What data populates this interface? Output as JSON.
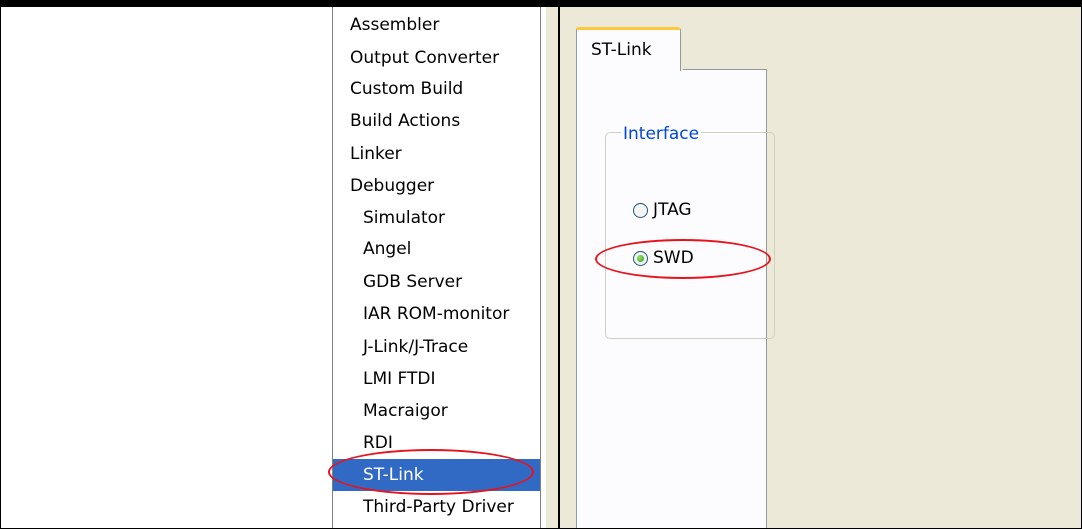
{
  "category_list": {
    "items": [
      {
        "label": "Assembler",
        "indent": 0
      },
      {
        "label": "Output Converter",
        "indent": 0
      },
      {
        "label": "Custom Build",
        "indent": 0
      },
      {
        "label": "Build Actions",
        "indent": 0
      },
      {
        "label": "Linker",
        "indent": 0
      },
      {
        "label": "Debugger",
        "indent": 0
      },
      {
        "label": "Simulator",
        "indent": 1
      },
      {
        "label": "Angel",
        "indent": 1
      },
      {
        "label": "GDB Server",
        "indent": 1
      },
      {
        "label": "IAR ROM-monitor",
        "indent": 1
      },
      {
        "label": "J-Link/J-Trace",
        "indent": 1
      },
      {
        "label": "LMI FTDI",
        "indent": 1
      },
      {
        "label": "Macraigor",
        "indent": 1
      },
      {
        "label": "RDI",
        "indent": 1
      },
      {
        "label": "ST-Link",
        "indent": 1,
        "selected": true
      },
      {
        "label": "Third-Party Driver",
        "indent": 1
      }
    ]
  },
  "options": {
    "tab_label": "ST-Link",
    "interface_group": {
      "caption": "Interface",
      "options": [
        {
          "label": "JTAG",
          "checked": false
        },
        {
          "label": "SWD",
          "checked": true
        }
      ]
    }
  },
  "colors": {
    "selection": "#316ac5",
    "annotation": "#e8121c",
    "groupbox_caption": "#0046d5",
    "tab_highlight": "#ffc83c"
  }
}
